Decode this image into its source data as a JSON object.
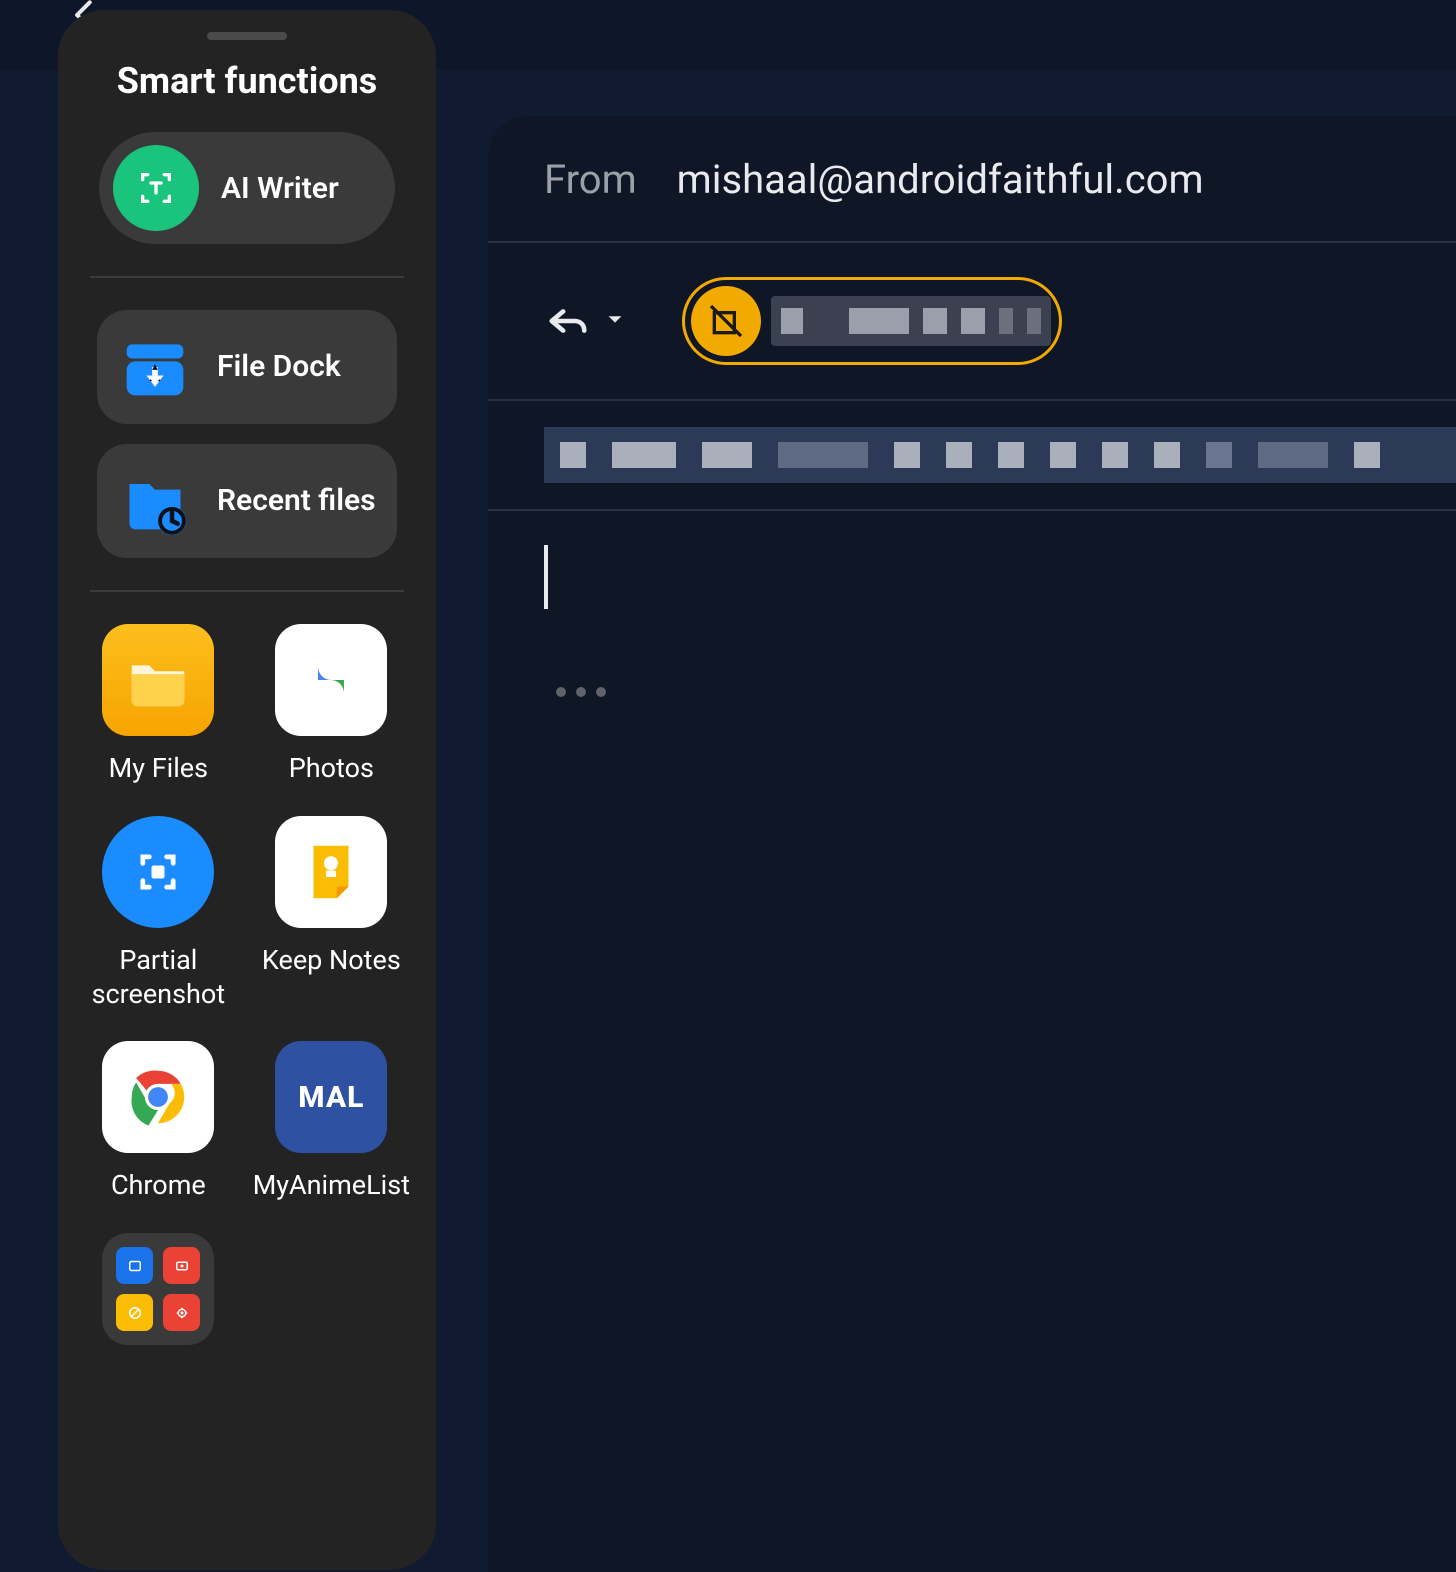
{
  "panel": {
    "title": "Smart functions",
    "ai_writer": {
      "label": "AI Writer",
      "icon": "text-scan-icon",
      "color": "#1bc47d"
    },
    "tiles": [
      {
        "label": "File Dock",
        "icon": "file-dock-icon",
        "color": "#1a8cff"
      },
      {
        "label": "Recent files",
        "icon": "recent-files-icon",
        "color": "#1a8cff"
      }
    ],
    "apps": [
      {
        "label": "My Files",
        "icon": "my-files-icon"
      },
      {
        "label": "Photos",
        "icon": "google-photos-icon"
      },
      {
        "label": "Partial screenshot",
        "icon": "partial-screenshot-icon"
      },
      {
        "label": "Keep Notes",
        "icon": "keep-notes-icon"
      },
      {
        "label": "Chrome",
        "icon": "chrome-icon"
      },
      {
        "label": "MyAnimeList",
        "icon": "mal-icon"
      }
    ],
    "folder_items": [
      {
        "color": "#1a73e8"
      },
      {
        "color": "#ea4335"
      },
      {
        "color": "#fbbc04"
      },
      {
        "color": "#ea4335"
      }
    ]
  },
  "compose": {
    "from_label": "From",
    "from_email": "mishaal@androidfaithful.com"
  },
  "colors": {
    "accent_orange": "#f2a900",
    "panel_bg": "#232323",
    "tile_bg": "#3a3a3a"
  }
}
